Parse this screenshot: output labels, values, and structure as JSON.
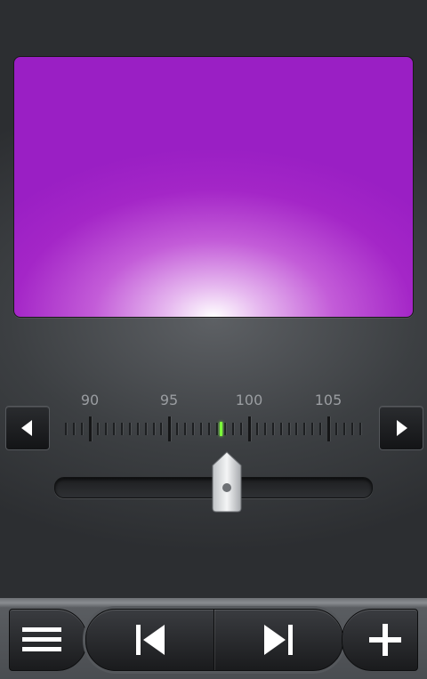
{
  "station_display": {
    "color": "#a426c7"
  },
  "tuner": {
    "frequency_labels": [
      "90",
      "95",
      "100",
      "105"
    ],
    "current_frequency": 98.2,
    "indicator_color": "#7cff3a"
  },
  "controls": {
    "prev_icon": "chevron-left-icon",
    "next_icon": "chevron-right-icon",
    "volume_slider_level": 0.55
  },
  "toolbar": {
    "menu_icon": "menu-icon",
    "previous_icon": "skip-previous-icon",
    "next_icon": "skip-next-icon",
    "add_icon": "plus-icon"
  }
}
